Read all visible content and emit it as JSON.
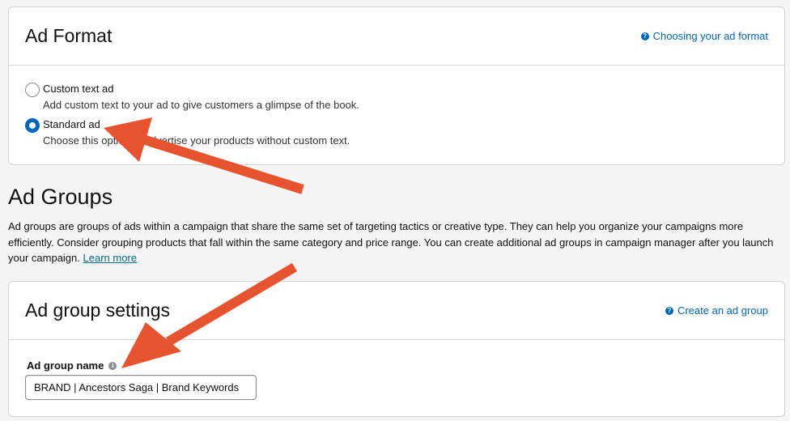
{
  "ad_format": {
    "title": "Ad Format",
    "help_link": "Choosing your ad format",
    "options": [
      {
        "label": "Custom text ad",
        "description": "Add custom text to your ad to give customers a glimpse of the book.",
        "selected": false
      },
      {
        "label": "Standard ad",
        "description": "Choose this option to advertise your products without custom text.",
        "selected": true
      }
    ]
  },
  "ad_groups": {
    "title": "Ad Groups",
    "description": "Ad groups are groups of ads within a campaign that share the same set of targeting tactics or creative type. They can help you organize your campaigns more efficiently. Consider grouping products that fall within the same category and price range. You can create additional ad groups in campaign manager after you launch your campaign.",
    "learn_more": "Learn more"
  },
  "ad_group_settings": {
    "title": "Ad group settings",
    "help_link": "Create an ad group",
    "name_label": "Ad group name",
    "name_value": "BRAND | Ancestors Saga | Brand Keywords"
  },
  "colors": {
    "link": "#0066c0",
    "radio_selected": "#0066c0",
    "annotation_arrow": "#e8532f"
  },
  "icons": {
    "help": "question-circle-icon",
    "info": "info-circle-icon"
  }
}
